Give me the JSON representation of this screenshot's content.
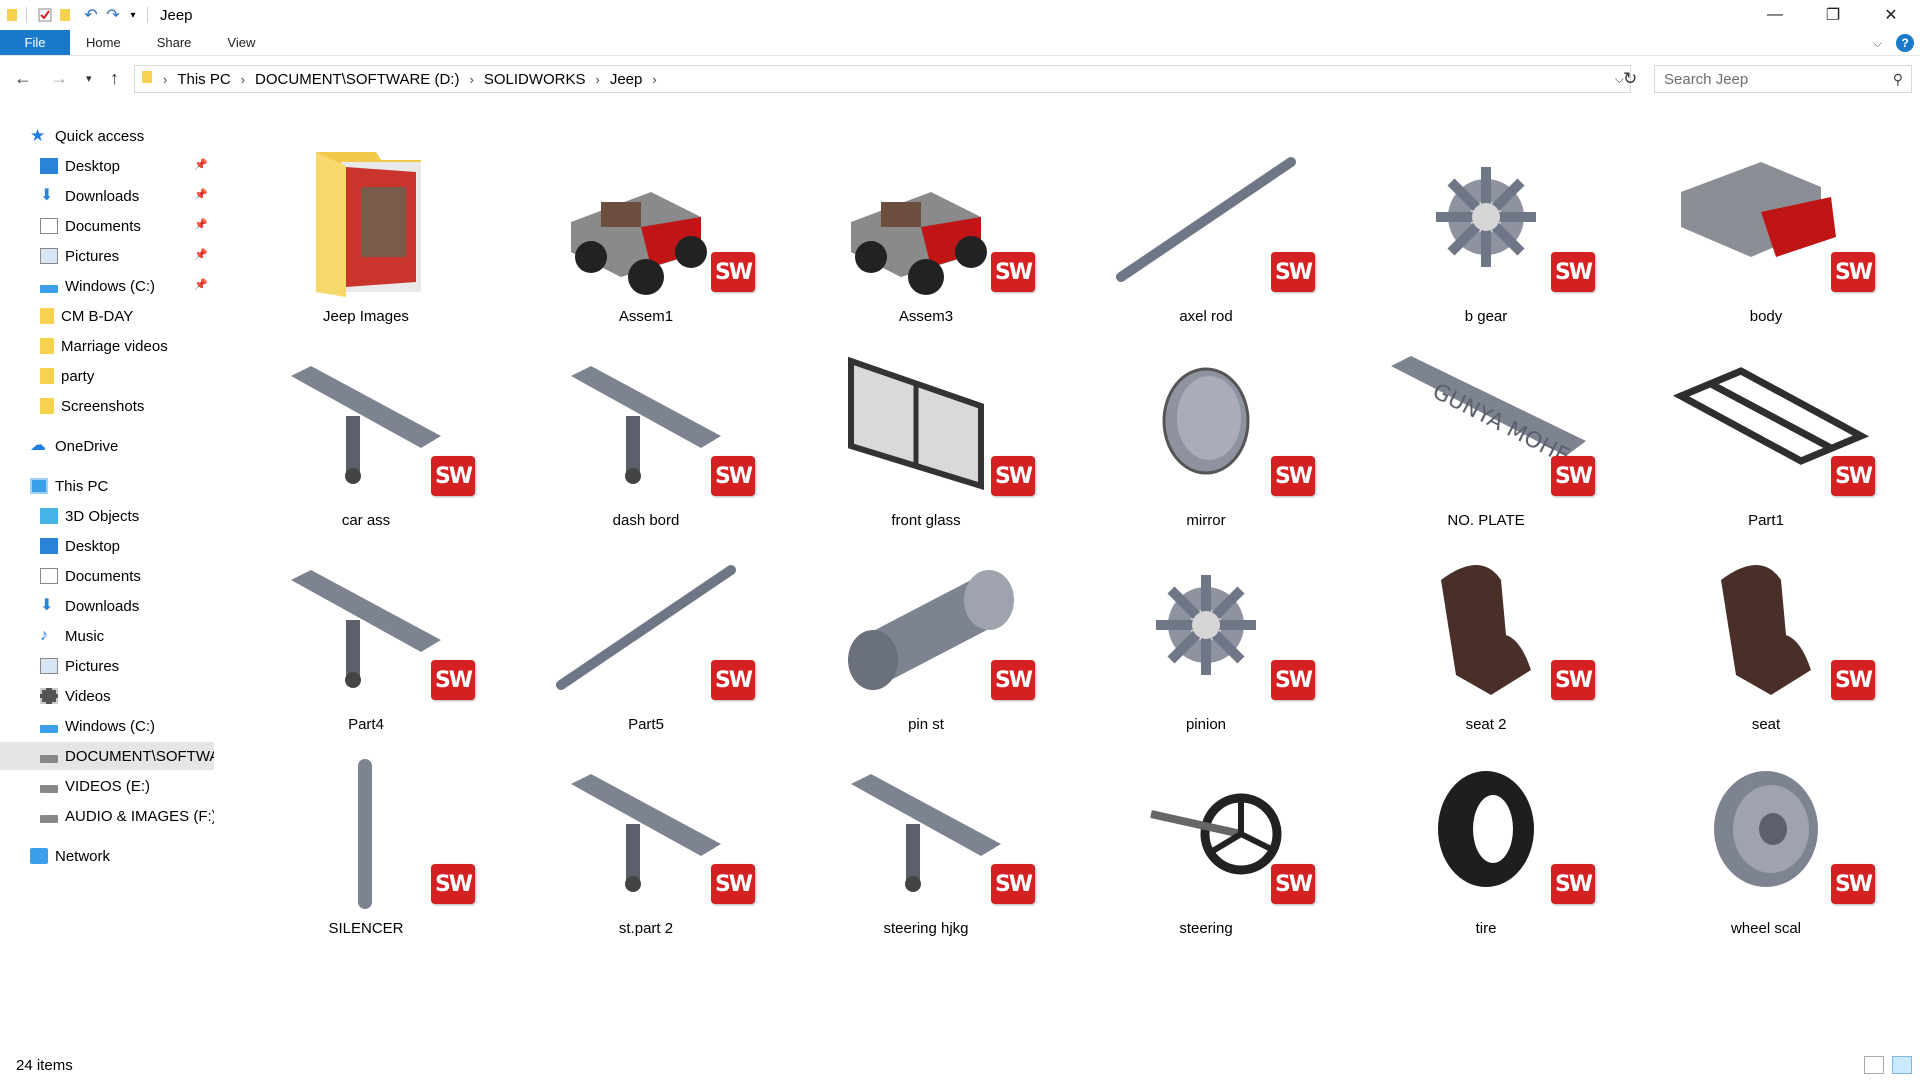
{
  "window": {
    "title": "Jeep",
    "minimize": "—",
    "maximize": "❐",
    "close": "✕"
  },
  "ribbon": {
    "file": "File",
    "tabs": [
      "Home",
      "Share",
      "View"
    ],
    "help": "?"
  },
  "address": {
    "crumbs": [
      "This PC",
      "DOCUMENT\\SOFTWARE (D:)",
      "SOLIDWORKS",
      "Jeep"
    ],
    "search_placeholder": "Search Jeep"
  },
  "sidebar": {
    "quick_access": "Quick access",
    "quick_items": [
      {
        "label": "Desktop",
        "pinned": true
      },
      {
        "label": "Downloads",
        "pinned": true
      },
      {
        "label": "Documents",
        "pinned": true
      },
      {
        "label": "Pictures",
        "pinned": true
      },
      {
        "label": "Windows (C:)",
        "pinned": true
      },
      {
        "label": "CM B-DAY",
        "pinned": false
      },
      {
        "label": "Marriage videos",
        "pinned": false
      },
      {
        "label": "party",
        "pinned": false
      },
      {
        "label": "Screenshots",
        "pinned": false
      }
    ],
    "onedrive": "OneDrive",
    "this_pc": "This PC",
    "pc_items": [
      "3D Objects",
      "Desktop",
      "Documents",
      "Downloads",
      "Music",
      "Pictures",
      "Videos",
      "Windows (C:)",
      "DOCUMENT\\SOFTWARE (D:)",
      "VIDEOS (E:)",
      "AUDIO & IMAGES (F:)"
    ],
    "network": "Network"
  },
  "files": [
    {
      "name": "Jeep Images",
      "icon": "folder-icon",
      "sw": false
    },
    {
      "name": "Assem1",
      "icon": "jeep-icon",
      "sw": true
    },
    {
      "name": "Assem3",
      "icon": "jeep-icon",
      "sw": true
    },
    {
      "name": "axel rod",
      "icon": "rod-icon",
      "sw": true
    },
    {
      "name": "b gear",
      "icon": "gear-icon",
      "sw": true
    },
    {
      "name": "body",
      "icon": "body-icon",
      "sw": true
    },
    {
      "name": "car ass",
      "icon": "part-icon",
      "sw": true
    },
    {
      "name": "dash bord",
      "icon": "part-icon",
      "sw": true
    },
    {
      "name": "front glass",
      "icon": "glass-icon",
      "sw": true
    },
    {
      "name": "mirror",
      "icon": "mirror-icon",
      "sw": true
    },
    {
      "name": "NO. PLATE",
      "icon": "plate-icon",
      "sw": true
    },
    {
      "name": "Part1",
      "icon": "frame-icon",
      "sw": true
    },
    {
      "name": "Part4",
      "icon": "part-icon",
      "sw": true
    },
    {
      "name": "Part5",
      "icon": "rod-icon",
      "sw": true
    },
    {
      "name": "pin st",
      "icon": "cylinder-icon",
      "sw": true
    },
    {
      "name": "pinion",
      "icon": "gear-icon",
      "sw": true
    },
    {
      "name": "seat 2",
      "icon": "seat-icon",
      "sw": true
    },
    {
      "name": "seat",
      "icon": "seat-icon",
      "sw": true
    },
    {
      "name": "SILENCER",
      "icon": "pipe-icon",
      "sw": true
    },
    {
      "name": "st.part 2",
      "icon": "part-icon",
      "sw": true
    },
    {
      "name": "steering hjkg",
      "icon": "part-icon",
      "sw": true
    },
    {
      "name": "steering",
      "icon": "wheel-icon",
      "sw": true
    },
    {
      "name": "tire",
      "icon": "tire-icon",
      "sw": true
    },
    {
      "name": "wheel scal",
      "icon": "rim-icon",
      "sw": true
    }
  ],
  "badge_text": "SW",
  "status": {
    "count": "24 items"
  },
  "colors": {
    "file_tab": "#1979ca",
    "sw_badge": "#d42020",
    "folder": "#f7d24e",
    "selected": "#e5e5e5"
  }
}
